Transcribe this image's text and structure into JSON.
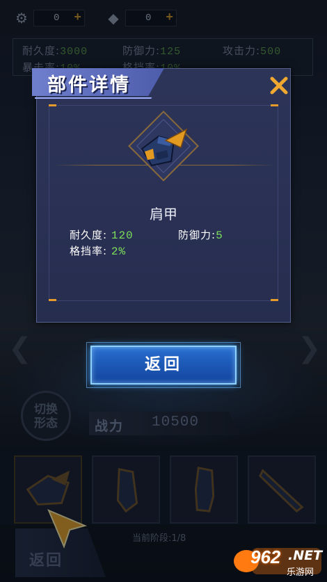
{
  "colors": {
    "accent_orange": "#e79b2a",
    "modal_bg": "#2a3155",
    "title_ribbon": "#6f7fcd",
    "stat_value_green": "#7ddf5a",
    "button_blue": "#1c58b5"
  },
  "top_bar": {
    "resources": [
      {
        "icon": "gear-coin-icon",
        "value": "0"
      },
      {
        "icon": "diamond-icon",
        "value": "0"
      }
    ]
  },
  "background_stats": {
    "durability_label": "耐久度:",
    "durability_value": "3000",
    "defense_label": "防御力:",
    "defense_value": "125",
    "attack_label": "攻击力:",
    "attack_value": "500",
    "crit_label": "暴击率:",
    "crit_value": "10%",
    "evade_label": "格挡率:",
    "evade_value": "10%"
  },
  "modal": {
    "title": "部件详情",
    "part_name": "肩甲",
    "attributes": [
      {
        "label": "耐久度:",
        "value": "120"
      },
      {
        "label": "防御力:",
        "value": "5"
      },
      {
        "label": "格挡率:",
        "value": "2%"
      }
    ],
    "return_label": "返回"
  },
  "power": {
    "label": "战力",
    "value": "10500"
  },
  "switch_form_label": [
    "切换",
    "形态"
  ],
  "parts": [
    {
      "icon": "shoulder-armor-icon"
    },
    {
      "icon": "arm-armor-icon"
    },
    {
      "icon": "leg-armor-icon"
    },
    {
      "icon": "blade-weapon-icon"
    }
  ],
  "stage_text": "当前阶段:1/8",
  "bg_return_label": "返回",
  "watermark": {
    "number": "962",
    "suffix": ".NET",
    "site_name": "乐游网"
  }
}
